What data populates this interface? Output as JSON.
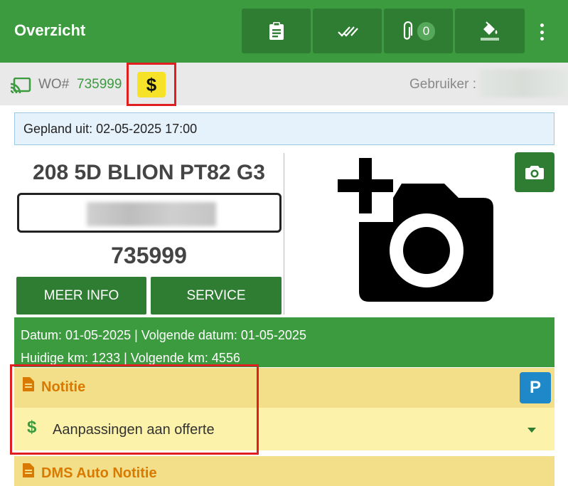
{
  "appbar": {
    "title": "Overzicht",
    "attachments_count": "0"
  },
  "wobar": {
    "wo_label": "WO#",
    "wo_number": "735999",
    "dollar_symbol": "$",
    "user_label": "Gebruiker :"
  },
  "gepland": {
    "text": "Gepland uit: 02-05-2025 17:00"
  },
  "vehicle": {
    "title": "208 5D BLION PT82 G3",
    "number": "735999",
    "more_info_label": "MEER INFO",
    "service_label": "SERVICE"
  },
  "dates": {
    "line1": "Datum: 01-05-2025 | Volgende datum: 01-05-2025",
    "line2": "Huidige km: 1233 | Volgende km: 4556"
  },
  "notitie": {
    "title": "Notitie",
    "p_badge": "P",
    "row_symbol": "$",
    "row_label": "Aanpassingen aan offerte"
  },
  "dms": {
    "title": "DMS Auto Notitie"
  },
  "colors": {
    "primary_green": "#3c9a3f",
    "dark_green": "#2f7d33",
    "highlight_red": "#e02020",
    "note_yellow": "#f3df8a",
    "dollar_yellow": "#f7e22a",
    "p_blue": "#1e88c9"
  },
  "icons": [
    "clipboard-icon",
    "double-check-icon",
    "paperclip-icon",
    "paint-bucket-icon",
    "more-vert-icon",
    "cast-icon",
    "add-photo-icon",
    "camera-icon",
    "document-icon",
    "dropdown-arrow-icon"
  ]
}
